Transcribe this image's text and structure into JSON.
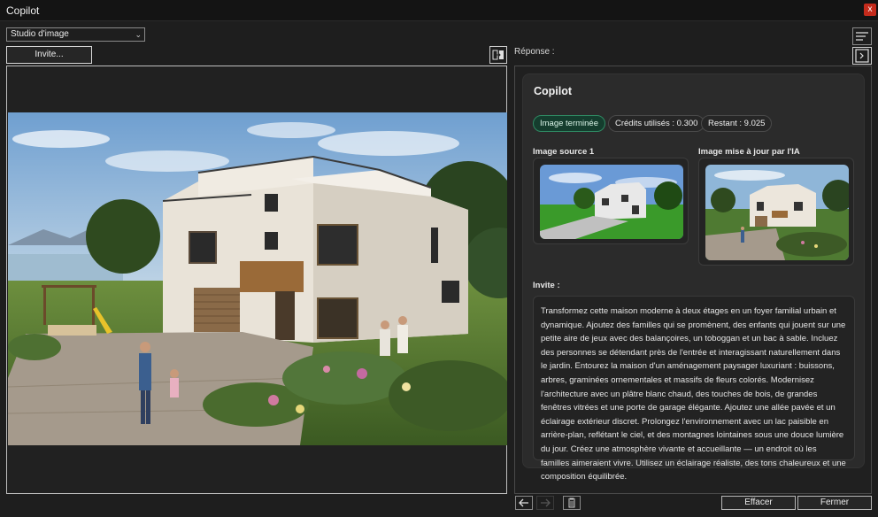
{
  "window": {
    "title": "Copilot",
    "close_label": "x"
  },
  "toolbar": {
    "mode_selected": "Studio d'image",
    "invite_label": "Invite..."
  },
  "icons": {
    "chevron": "chevron-down-icon",
    "swap": "compare-swap-icon",
    "sort": "sort-lines-icon",
    "collapse": "panel-collapse-icon",
    "back": "arrow-left-icon",
    "forward": "arrow-right-icon",
    "trash": "trash-icon"
  },
  "response": {
    "label": "Réponse :",
    "card_title": "Copilot",
    "status_badge": "Image terminée",
    "credits_badge": "Crédits utilisés : 0.300",
    "remaining_badge": "Restant : 9.025",
    "source_label": "Image source 1",
    "ai_label": "Image mise à jour par l'IA",
    "prompt_label": "Invite :",
    "prompt_text": "Transformez cette maison moderne à deux étages en un foyer familial urbain et dynamique. Ajoutez des familles qui se promènent, des enfants qui jouent sur une petite aire de jeux avec des balançoires, un toboggan et un bac à sable. Incluez des personnes se détendant près de l'entrée et interagissant naturellement dans le jardin. Entourez la maison d'un aménagement paysager luxuriant : buissons, arbres, graminées ornementales et massifs de fleurs colorés. Modernisez l'architecture avec un plâtre blanc chaud, des touches de bois, de grandes fenêtres vitrées et une porte de garage élégante. Ajoutez une allée pavée et un éclairage extérieur discret. Prolongez l'environnement avec un lac paisible en arrière-plan, reflétant le ciel, et des montagnes lointaines sous une douce lumière du jour. Créez une atmosphère vivante et accueillante — un endroit où les familles aimeraient vivre. Utilisez un éclairage réaliste, des tons chaleureux et une composition équilibrée."
  },
  "footer": {
    "clear_label": "Effacer",
    "close_label": "Fermer"
  },
  "colors": {
    "background": "#1e1e1e",
    "accent_green": "#2f8a63",
    "close_red": "#c42b1c"
  }
}
